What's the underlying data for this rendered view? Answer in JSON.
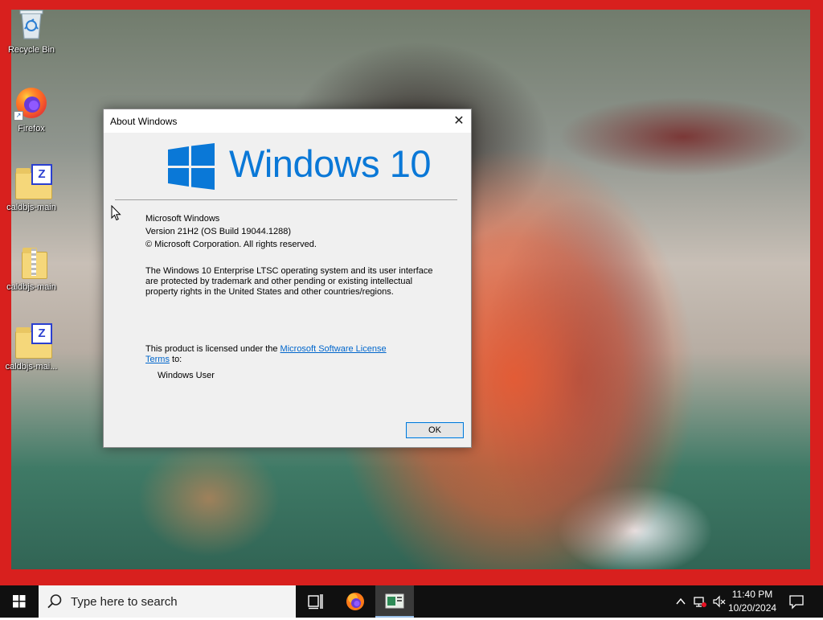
{
  "desktop": {
    "icons": [
      {
        "label": "Recycle Bin"
      },
      {
        "label": "Firefox"
      },
      {
        "label": "caldbjs-main"
      },
      {
        "label": "caldbjs-main"
      },
      {
        "label": "caldbjs-mai..."
      }
    ]
  },
  "dialog": {
    "title": "About Windows",
    "close_glyph": "✕",
    "logo_text": "Windows 10",
    "product_name": "Microsoft Windows",
    "version": "Version 21H2 (OS Build 19044.1288)",
    "copyright": "© Microsoft Corporation. All rights reserved.",
    "description": "The Windows 10 Enterprise LTSC operating system and its user interface are protected by trademark and other pending or existing intellectual property rights in the United States and other countries/regions.",
    "license_prefix": "This product is licensed under the ",
    "license_link": "Microsoft Software License Terms",
    "license_suffix": " to:",
    "licensed_user": "Windows User",
    "ok_label": "OK"
  },
  "taskbar": {
    "search_placeholder": "Type here to search",
    "time": "11:40 PM",
    "date": "10/20/2024",
    "pinned": [
      {
        "name": "task-view-icon"
      },
      {
        "name": "firefox-icon"
      },
      {
        "name": "about-windows-app-icon",
        "active": true
      }
    ],
    "tray": [
      "chevron-up-icon",
      "network-icon",
      "volume-muted-icon",
      "notification-icon"
    ]
  },
  "colors": {
    "frame_red": "#d8201e",
    "windows_blue": "#0a78d7",
    "taskbar": "#101010",
    "link": "#0066cc"
  }
}
